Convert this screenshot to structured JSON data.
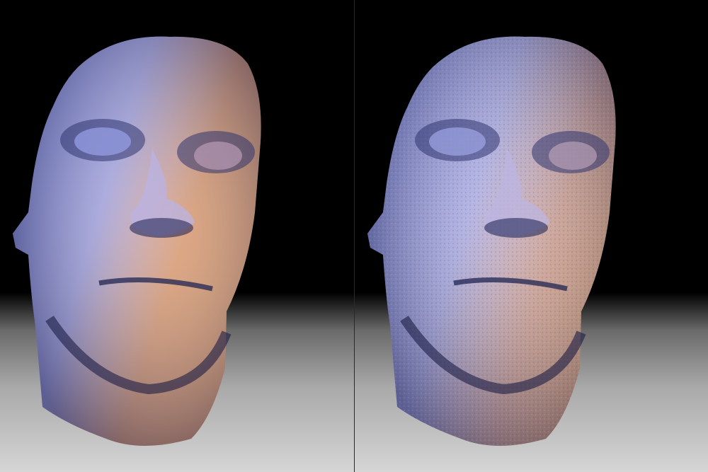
{
  "viewer": {
    "layout": "side-by-side",
    "panels": [
      {
        "surface": "smooth"
      },
      {
        "surface": "fine-detail"
      }
    ],
    "colors": {
      "background_top": "#000000",
      "floor_bottom": "#d6d6d6",
      "skin_warm": "#e9a067",
      "skin_cool": "#8f9ae8",
      "shadow": "#262a55"
    }
  }
}
